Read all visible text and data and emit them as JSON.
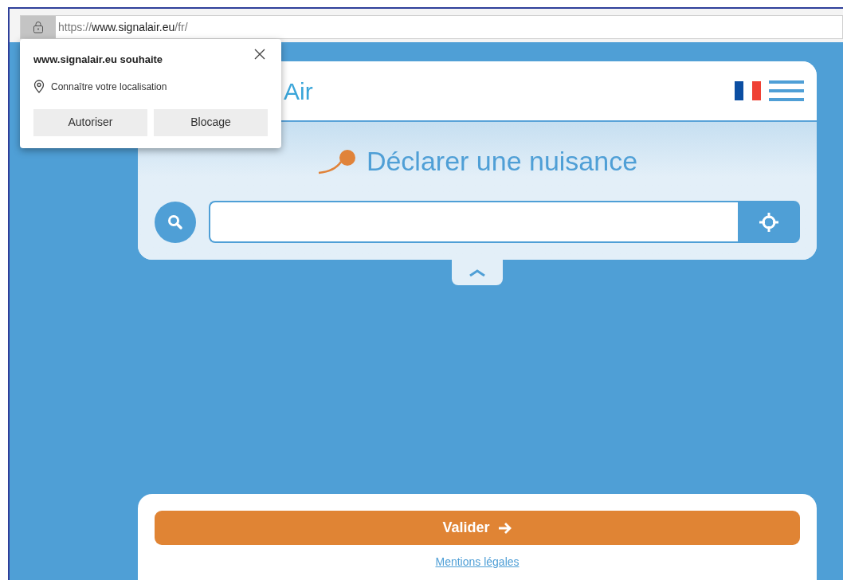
{
  "address_bar": {
    "scheme": "https://",
    "host": "www.signalair.eu",
    "path": "/fr/"
  },
  "permission_popup": {
    "title": "www.signalair.eu souhaite",
    "request": "Connaître votre localisation",
    "buttons": [
      "Autoriser",
      "Blocage"
    ]
  },
  "header": {
    "logo_text": "Air"
  },
  "search_panel": {
    "title": "Déclarer une nuisance"
  },
  "footer": {
    "submit": "Valider",
    "link": "Mentions légales"
  }
}
